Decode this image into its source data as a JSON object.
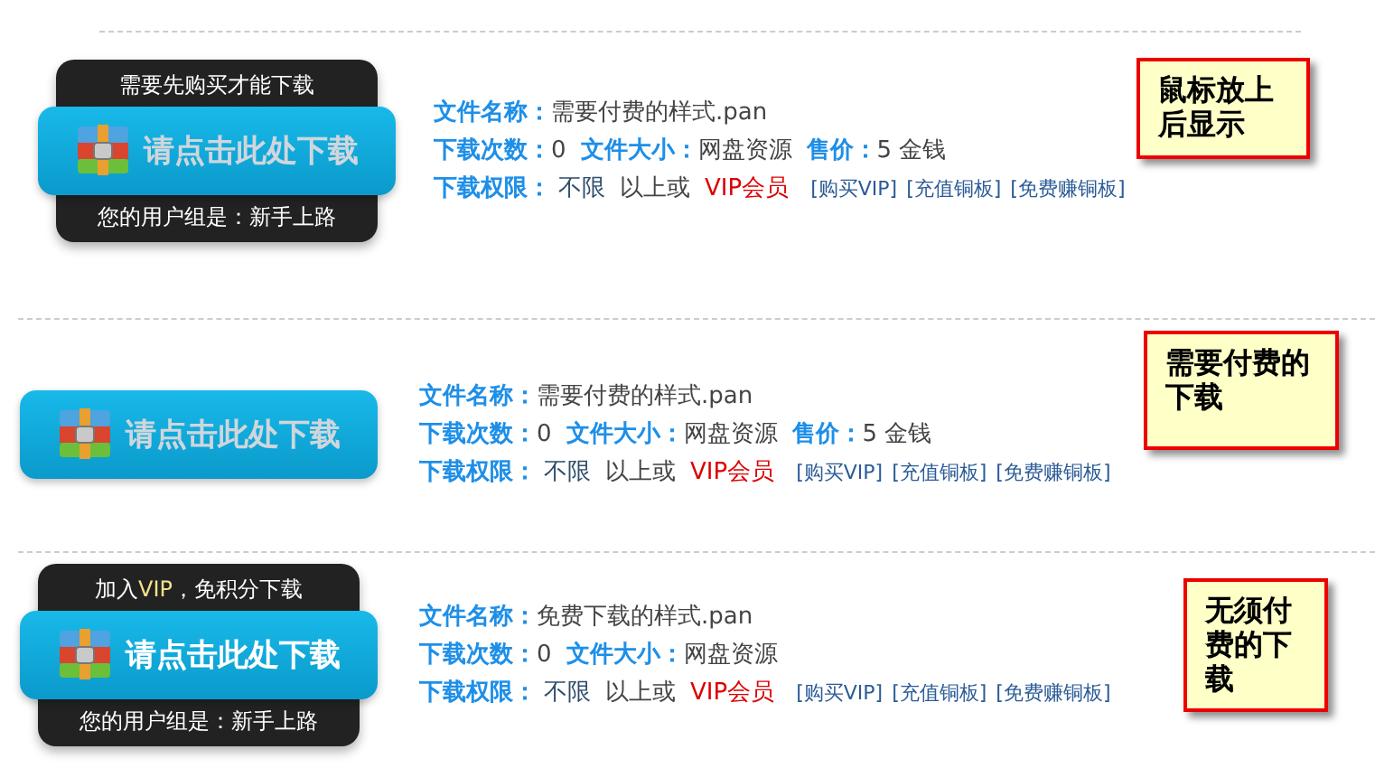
{
  "items": [
    {
      "popup": {
        "top": "需要先购买才能下载",
        "bottom": "您的用户组是：新手上路"
      },
      "button": {
        "label": "请点击此处下载",
        "disabled": true
      },
      "lines": [
        [
          {
            "label": "文件名称：",
            "value": "需要付费的样式.pan"
          }
        ],
        [
          {
            "label": "下载次数：",
            "value": "0"
          },
          {
            "label": "文件大小：",
            "value": "网盘资源"
          },
          {
            "label": "售价：",
            "value": "5 金钱"
          }
        ]
      ],
      "permission": {
        "label": "下载权限：",
        "value": "不限",
        "suffix": "以上或",
        "vip": "VIP会员",
        "links": [
          "[购买VIP]",
          "[充值铜板]",
          "[免费赚铜板]"
        ]
      },
      "note": "鼠标放上后显示"
    },
    {
      "button": {
        "label": "请点击此处下载",
        "disabled": true
      },
      "lines": [
        [
          {
            "label": "文件名称：",
            "value": "需要付费的样式.pan"
          }
        ],
        [
          {
            "label": "下载次数：",
            "value": "0"
          },
          {
            "label": "文件大小：",
            "value": "网盘资源"
          },
          {
            "label": "售价：",
            "value": "5 金钱"
          }
        ]
      ],
      "permission": {
        "label": "下载权限：",
        "value": "不限",
        "suffix": "以上或",
        "vip": "VIP会员",
        "links": [
          "[购买VIP]",
          "[充值铜板]",
          "[免费赚铜板]"
        ]
      },
      "note": "需要付费的下载"
    },
    {
      "popup": {
        "top": "加入**VIP**，免积分下载",
        "bottom": "您的用户组是：新手上路"
      },
      "button": {
        "label": "请点击此处下载",
        "disabled": false
      },
      "lines": [
        [
          {
            "label": "文件名称：",
            "value": "免费下载的样式.pan"
          }
        ],
        [
          {
            "label": "下载次数：",
            "value": "0"
          },
          {
            "label": "文件大小：",
            "value": "网盘资源"
          }
        ]
      ],
      "permission": {
        "label": "下载权限：",
        "value": "不限",
        "suffix": "以上或",
        "vip": "VIP会员",
        "links": [
          "[购买VIP]",
          "[充值铜板]",
          "[免费赚铜板]"
        ]
      },
      "note": "无须付费的下载"
    }
  ]
}
